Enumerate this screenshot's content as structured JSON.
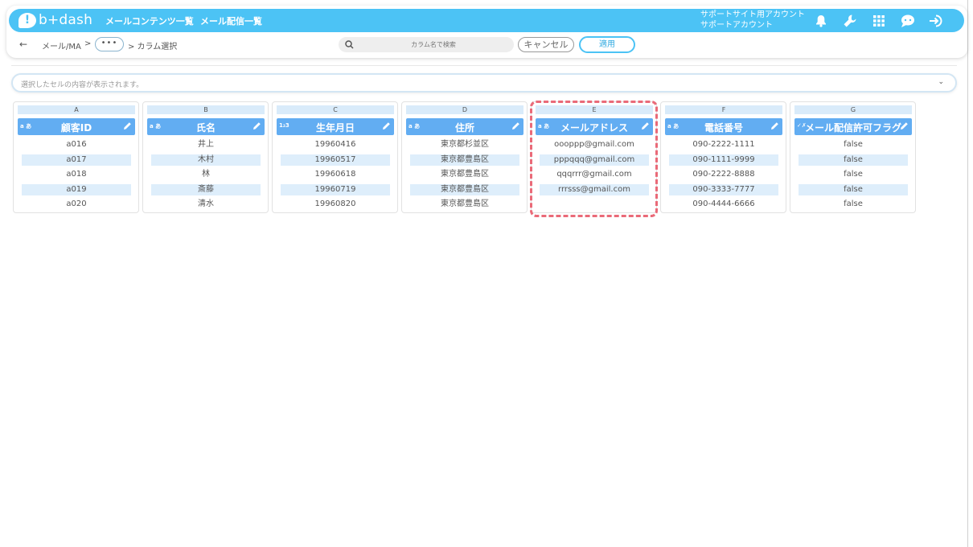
{
  "app": {
    "logo_text": "b+dash",
    "logo_mark": "!",
    "nav": [
      "メールコンテンツ一覧",
      "メール配信一覧"
    ],
    "account": {
      "line1": "サポートサイト用アカウント",
      "line2": "サポートアカウント"
    }
  },
  "icons": [
    "bell-icon",
    "wrench-icon",
    "grid-icon",
    "chat-icon",
    "logout-icon",
    "search-icon",
    "pencil-icon",
    "chevron-down-icon"
  ],
  "breadcrumb": {
    "back": "←",
    "root": "メール/MA",
    "sep": ">",
    "ellipsis": "•••",
    "current": "> カラム選択"
  },
  "search": {
    "placeholder": "カラム名で検索"
  },
  "buttons": {
    "cancel": "キャンセル",
    "apply": "適用"
  },
  "cell_bar": {
    "placeholder": "選択したセルの内容が表示されます。",
    "chevron": "⌄"
  },
  "columns": [
    {
      "letter": "A",
      "type": "a あ",
      "name": "顧客ID",
      "values": [
        "a016",
        "a017",
        "a018",
        "a019",
        "a020"
      ]
    },
    {
      "letter": "B",
      "type": "a あ",
      "name": "氏名",
      "values": [
        "井上",
        "木村",
        "林",
        "斎藤",
        "清水"
      ]
    },
    {
      "letter": "C",
      "type": "1₂3",
      "name": "生年月日",
      "values": [
        "19960416",
        "19960517",
        "19960618",
        "19960719",
        "19960820"
      ]
    },
    {
      "letter": "D",
      "type": "a あ",
      "name": "住所",
      "values": [
        "東京都杉並区",
        "東京都豊島区",
        "東京都豊島区",
        "東京都豊島区",
        "東京都豊島区"
      ]
    },
    {
      "letter": "E",
      "type": "a あ",
      "name": "メールアドレス",
      "values": [
        "oooppp@gmail.com",
        "pppqqq@gmail.com",
        "qqqrrr@gmail.com",
        "rrrsss@gmail.com"
      ]
    },
    {
      "letter": "F",
      "type": "a あ",
      "name": "電話番号",
      "values": [
        "090-2222-1111",
        "090-1111-9999",
        "090-2222-8888",
        "090-3333-7777",
        "090-4444-6666"
      ]
    },
    {
      "letter": "G",
      "type": "✓✗",
      "name": "メール配信許可フラグ",
      "values": [
        "false",
        "false",
        "false",
        "false",
        "false"
      ]
    }
  ],
  "colors": {
    "topbar": "#4cc3f5",
    "header_fill": "#62adf2",
    "row_alt": "#deeefb",
    "highlight": "#ea6a78"
  }
}
